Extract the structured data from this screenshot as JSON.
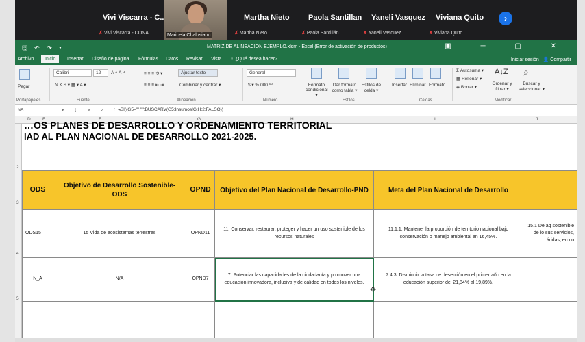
{
  "meeting": {
    "participants": [
      {
        "name": "Vivi Viscarra - C...",
        "sub": "Vivi Viscarra - CONA..."
      },
      {
        "name": "Martha Nieto",
        "sub": "Martha Nieto"
      },
      {
        "name": "Paola Santillan",
        "sub": "Paola Santillán"
      },
      {
        "name": "Yaneli Vasquez",
        "sub": "Yaneli Vasquez"
      },
      {
        "name": "Viviana Quito",
        "sub": "Viviana Quito"
      }
    ],
    "camera_label": "Maricela Chalusiano",
    "next_icon": "chevron-right-icon"
  },
  "excel": {
    "title": "MATRIZ DE ALINEACION EJEMPLO.xlsm - Excel (Error de activación de productos)",
    "qat": "🖫 ↶ ↷ ▾",
    "window_controls": "▣ ─ ▢ ✕",
    "tabs": [
      "Archivo",
      "Inicio",
      "Insertar",
      "Diseño de página",
      "Fórmulas",
      "Datos",
      "Revisar",
      "Vista",
      "♀ ¿Qué desea hacer?"
    ],
    "active_tab": "Inicio",
    "account": "Iniciar sesión",
    "share": "Compartir",
    "ribbon": {
      "paste": "Pegar",
      "clipboard": "Portapapeles",
      "font_name": "Calibri",
      "font_size": "12",
      "font_group": "Fuente",
      "font_buttons": "N K S ▾   ▦ ▾   A ▾",
      "wrap_text": "Ajustar texto",
      "merge": "Combinar y centrar ▾",
      "alignment_group": "Alineación",
      "number_format": "General",
      "number_buttons": "$ ▾ % 000  ⁰⁰",
      "number_group": "Número",
      "conditional_format": "Formato condicional ▾",
      "table_format": "Dar formato como tabla ▾",
      "cell_styles": "Estilos de celda ▾",
      "styles_group": "Estilos",
      "insert": "Insertar",
      "delete": "Eliminar",
      "format": "Formato",
      "cells_group": "Celdas",
      "autosum": "Autosuma ▾",
      "fill": "Rellenar ▾",
      "clear": "Borrar ▾",
      "sort_filter": "Ordenar y filtrar ▾",
      "find_select": "Buscar y seleccionar ▾",
      "editing_group": "Modificar"
    },
    "name_box": "N5",
    "formula_icons": "▾ ⋮ ✕ ✓ fx",
    "formula": "=SI((G5=\"\";\"\";BUSCARV(G5;Insumos!G:H;2;FALSO))",
    "columns": [
      "D",
      "E",
      "F",
      "G",
      "H",
      "I",
      "J"
    ],
    "rows": [
      "2",
      "3",
      "4",
      "5"
    ],
    "heading_cut": "…OS PLANES DE DESARROLLO Y ORDENAMIENTO TERRITORIAL",
    "heading": "IAD  AL PLAN NACIONAL DE DESARROLLO 2021-2025.",
    "table_headers": [
      "ODS",
      "Objetivo de Desarrollo Sostenible-ODS",
      "OPND",
      "Objetivo del Plan Nacional de Desarrollo-PND",
      "Meta del Plan Nacional de Desarrollo",
      ""
    ],
    "table_rows": [
      [
        "ODS15_",
        "15 Vida de ecosistemas terrestres",
        "OPND11",
        "11. Conservar, restaurar, proteger y hacer un uso sostenible de los recursos naturales",
        "11.1.1. Mantener la proporción de territorio nacional bajo conservación o manejo ambiental en 16,45%.",
        "15.1 De aq sostenible de lo sus servicios, áridas, en co"
      ],
      [
        "N_A",
        "N/A",
        "OPND7",
        "7. Potenciar las capacidades de la ciudadanía y promover una educación innovadora, inclusiva y de calidad en todos los niveles.",
        "7.4.3. Disminuir la tasa de deserción en el primer año en la educación superior del 21,84% al 19,89%.",
        ""
      ]
    ],
    "cursor_icon": "plus-cursor-icon"
  },
  "colors": {
    "excel_green": "#217346",
    "header_yellow": "#f7c52a",
    "call_bg": "#1d1d1f"
  }
}
